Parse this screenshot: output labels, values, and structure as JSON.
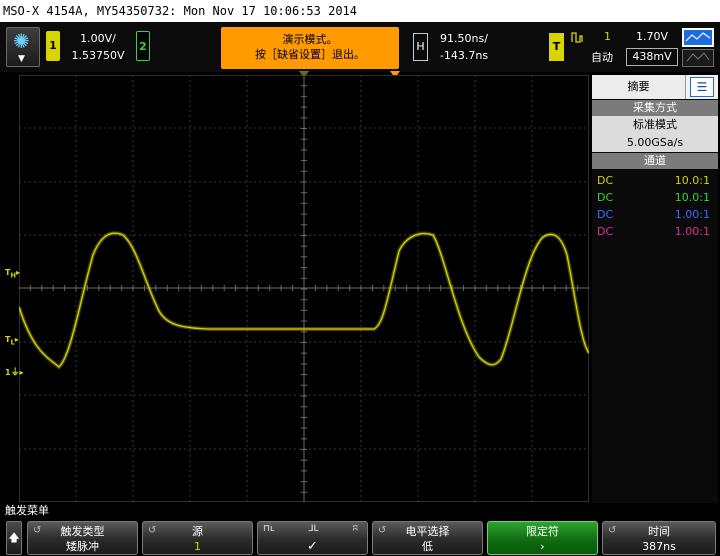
{
  "window": {
    "title": "MSO-X 4154A, MY54350732: Mon Nov 17 10:06:53 2014"
  },
  "status_bar": {
    "ch1": {
      "badge": "1",
      "scale": "1.00V/",
      "offset": "1.53750V",
      "color": "#d8d400"
    },
    "ch2": {
      "badge": "2",
      "color": "#37d437"
    },
    "demo_message": {
      "line1": "演示模式。",
      "line2": "按［缺省设置］退出。"
    },
    "horizontal": {
      "badge": "H",
      "time_per_div": "91.50ns/",
      "delay": "-143.7ns"
    },
    "trigger": {
      "badge": "T",
      "icon": "pulse-width-trigger-icon",
      "source": "1",
      "mode": "自动",
      "level": "1.70V",
      "level_box": "438mV"
    }
  },
  "side_panel": {
    "tab": "摘要",
    "acquisition": {
      "header": "采集方式",
      "mode": "标准模式",
      "rate": "5.00GSa/s"
    },
    "channels_header": "通道",
    "channels": [
      {
        "coupling": "DC",
        "ratio": "10.0:1",
        "color": "#d8d400"
      },
      {
        "coupling": "DC",
        "ratio": "10.0:1",
        "color": "#37d437"
      },
      {
        "coupling": "DC",
        "ratio": "1.00:1",
        "color": "#3f6bff"
      },
      {
        "coupling": "DC",
        "ratio": "1.00:1",
        "color": "#e0308a"
      }
    ]
  },
  "menu": {
    "title": "触发菜单",
    "softkeys": [
      {
        "label": "触发类型",
        "value": "矮脉冲"
      },
      {
        "label": "源",
        "value": "1"
      },
      {
        "label": "",
        "value": "✓"
      },
      {
        "label": "电平选择",
        "value": "低"
      },
      {
        "label": "限定符",
        "value": "›"
      },
      {
        "label": "时间",
        "value": "387ns"
      }
    ]
  },
  "waveform": {
    "channel": "1",
    "color": "#c8c400"
  }
}
